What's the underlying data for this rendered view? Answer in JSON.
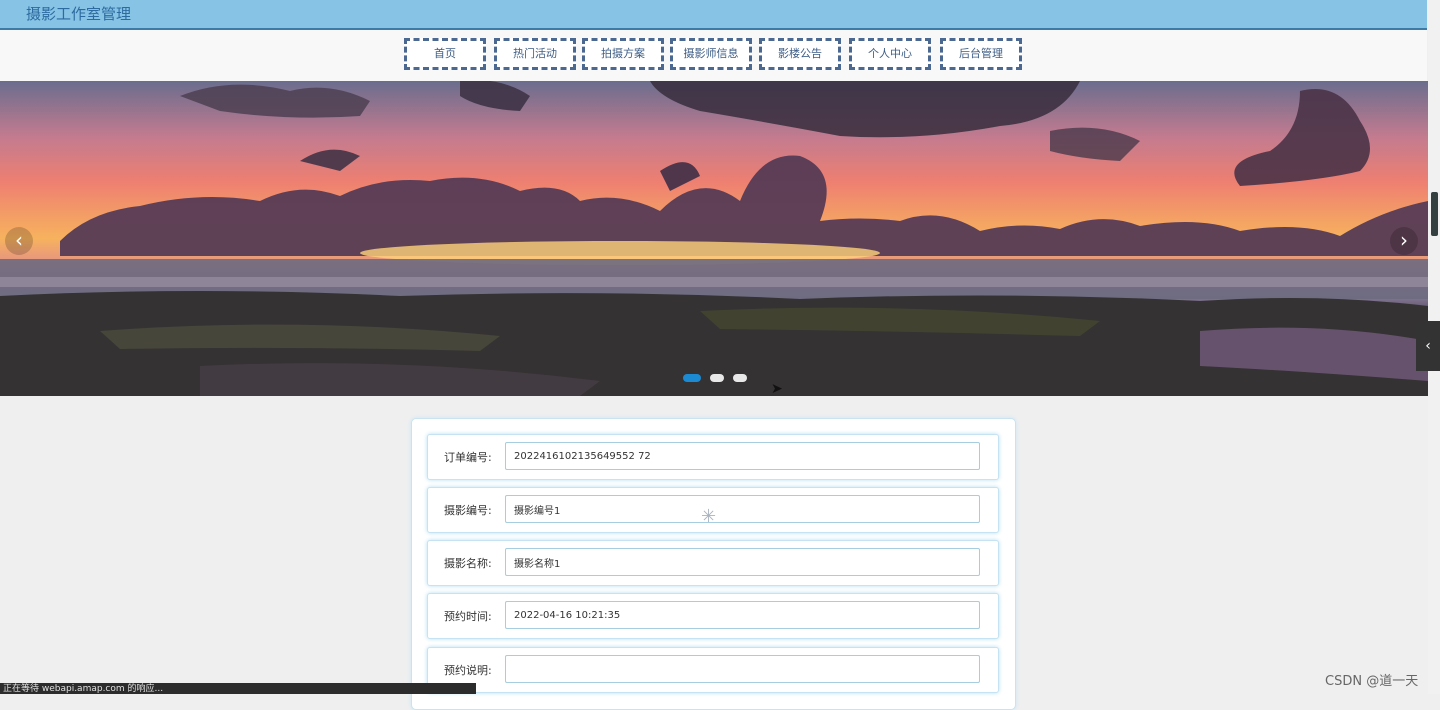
{
  "header": {
    "title": "摄影工作室管理"
  },
  "nav": {
    "items": [
      {
        "label": "首页"
      },
      {
        "label": "热门活动"
      },
      {
        "label": "拍摄方案"
      },
      {
        "label": "摄影师信息"
      },
      {
        "label": "影楼公告"
      },
      {
        "label": "个人中心"
      },
      {
        "label": "后台管理"
      }
    ]
  },
  "carousel": {
    "prev_icon": "chevron-left-icon",
    "next_icon": "chevron-right-icon",
    "slide_count": 3,
    "active_index": 0,
    "prev_glyph": "‹",
    "next_glyph": "›"
  },
  "form": {
    "fields": [
      {
        "label": "订单编号:",
        "value": "2022416102135649552 72"
      },
      {
        "label": "摄影编号:",
        "value": "摄影编号1"
      },
      {
        "label": "摄影名称:",
        "value": "摄影名称1"
      },
      {
        "label": "预约时间:",
        "value": "2022-04-16 10:21:35"
      },
      {
        "label": "预约说明:",
        "value": ""
      }
    ]
  },
  "side_tab": {
    "glyph": "‹"
  },
  "status_bar": {
    "text": "正在等待 webapi.amap.com 的响应..."
  },
  "watermark": {
    "text": "CSDN @道一天"
  },
  "colors": {
    "header_bg": "#87c3e5",
    "nav_border": "#4b6891",
    "active_dot": "#1b8ad2"
  }
}
